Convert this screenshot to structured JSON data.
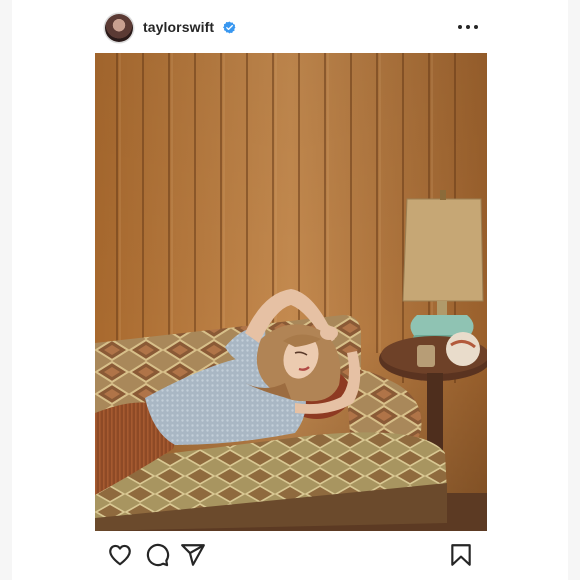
{
  "post": {
    "username": "taylorswift",
    "verified": true,
    "avatar": "profile-photo",
    "menu_icon": "more-options-icon"
  },
  "actions": {
    "like_icon": "heart-icon",
    "comment_icon": "comment-icon",
    "share_icon": "send-icon",
    "save_icon": "bookmark-icon"
  },
  "colors": {
    "verified_badge": "#3897f0",
    "text": "#262626"
  }
}
